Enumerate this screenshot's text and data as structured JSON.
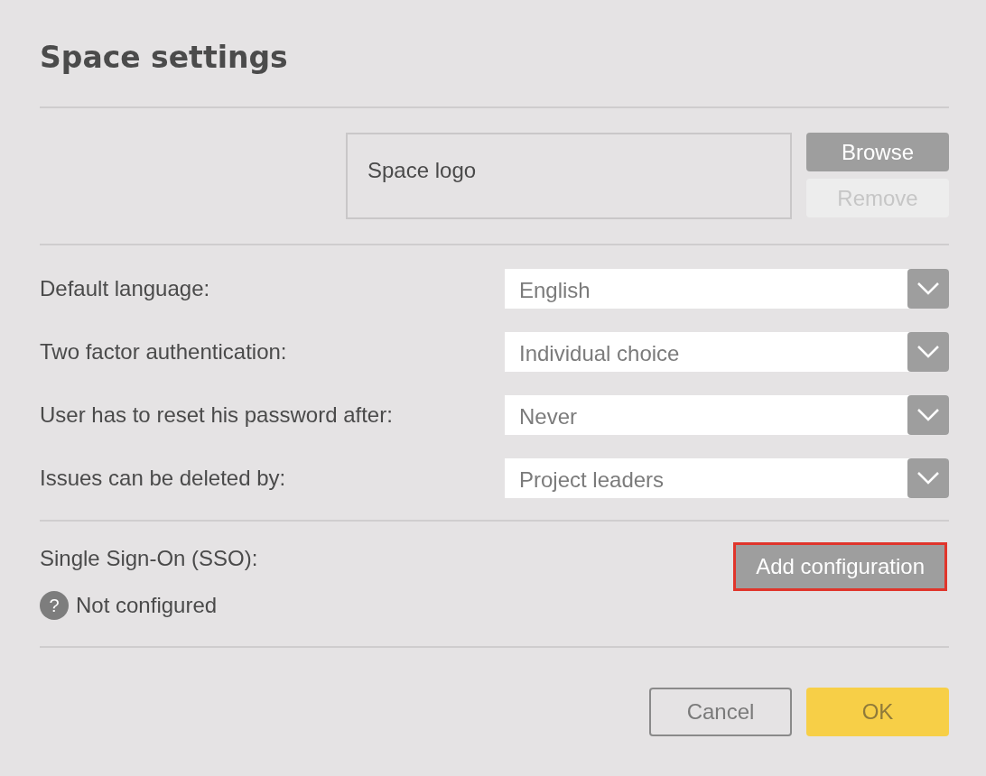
{
  "dialog": {
    "title": "Space settings"
  },
  "logo": {
    "label": "Space logo",
    "buttons": [
      {
        "label": "Browse",
        "disabled": false
      },
      {
        "label": "Remove",
        "disabled": true
      }
    ]
  },
  "settings": [
    {
      "label": "Default language:",
      "value": "English"
    },
    {
      "label": "Two factor authentication:",
      "value": "Individual choice"
    },
    {
      "label": "User has to reset his password after:",
      "value": "Never"
    },
    {
      "label": "Issues can be deleted by:",
      "value": "Project leaders"
    }
  ],
  "sso": {
    "label": "Single Sign-On (SSO):",
    "status_icon": "?",
    "status": "Not configured",
    "button": {
      "label": "Add configuration",
      "highlighted": true
    }
  },
  "footer": {
    "buttons": [
      {
        "label": "Cancel",
        "kind": "secondary"
      },
      {
        "label": "OK",
        "kind": "primary"
      }
    ]
  }
}
